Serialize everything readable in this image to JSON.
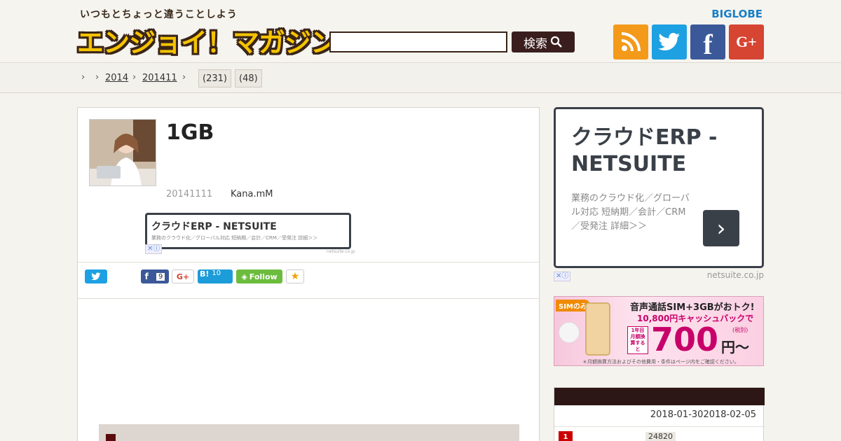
{
  "header": {
    "tagline": "いつもとちょっと違うことしよう",
    "logo": "エンジョイ！マガジン",
    "search_placeholder": "",
    "search_button": "検索",
    "biglobe": "BIGLOBE",
    "social": [
      {
        "name": "rss",
        "color": "#f39a1a"
      },
      {
        "name": "twitter",
        "color": "#1da1e2"
      },
      {
        "name": "facebook",
        "color": "#3b5998"
      },
      {
        "name": "google-plus",
        "color": "#d64432"
      }
    ]
  },
  "breadcrumb": {
    "year": "2014",
    "month": "201411",
    "count1": "(231)",
    "count2": "(48)"
  },
  "article": {
    "title": "1GB",
    "date": "20141111",
    "author": "Kana.mM",
    "ad_small": {
      "title": "クラウドERP - NETSUITE",
      "desc": "業務のクラウド化／グローバル対応 短納期／会計／CRM／受発注 詳細＞＞",
      "domain": "netsuite.co.jp"
    },
    "share": {
      "facebook_count": "9",
      "hatena_label": "B!",
      "hatena_count": "10",
      "follow_label": "Follow"
    }
  },
  "sidebar": {
    "ad_big": {
      "title": "クラウドERP - NETSUITE",
      "desc": "業務のクラウド化／グローバル対応 短納期／会計／CRM／受発注 詳細＞＞",
      "domain": "netsuite.co.jp"
    },
    "banner": {
      "tag": "SIMのみ",
      "line1": "音声通話SIM+3GBがおトク!",
      "line2": "10,800円キャッシュバックで",
      "badge": "1年目 月額換算すると",
      "price": "700",
      "unit": "円〜",
      "tax": "(税別)",
      "note": "＊月額換算方法およびその他費用・条件はページ内をご確認ください。"
    },
    "ranking": {
      "date_range": "2018-01-302018-02-05",
      "rank1": "1",
      "rank1_pv": "24820"
    }
  }
}
